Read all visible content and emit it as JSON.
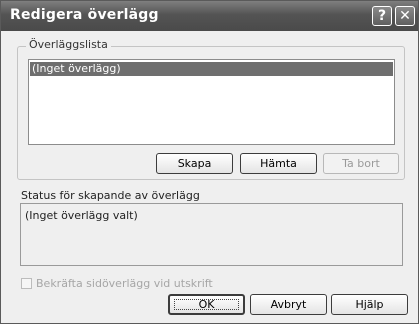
{
  "window": {
    "title": "Redigera överlägg",
    "help_glyph": "?",
    "close_glyph": "✕"
  },
  "overlay_list": {
    "legend": "Överläggslista",
    "items": [
      "(Inget överlägg)"
    ],
    "buttons": {
      "create": "Skapa",
      "fetch": "Hämta",
      "delete": "Ta bort"
    }
  },
  "status": {
    "label": "Status för skapande av överlägg",
    "text": "(Inget överlägg valt)"
  },
  "confirm": {
    "label": "Bekräfta sidöverlägg vid utskrift",
    "checked": false,
    "enabled": false
  },
  "footer": {
    "ok": "OK",
    "cancel": "Avbryt",
    "help": "Hjälp"
  }
}
